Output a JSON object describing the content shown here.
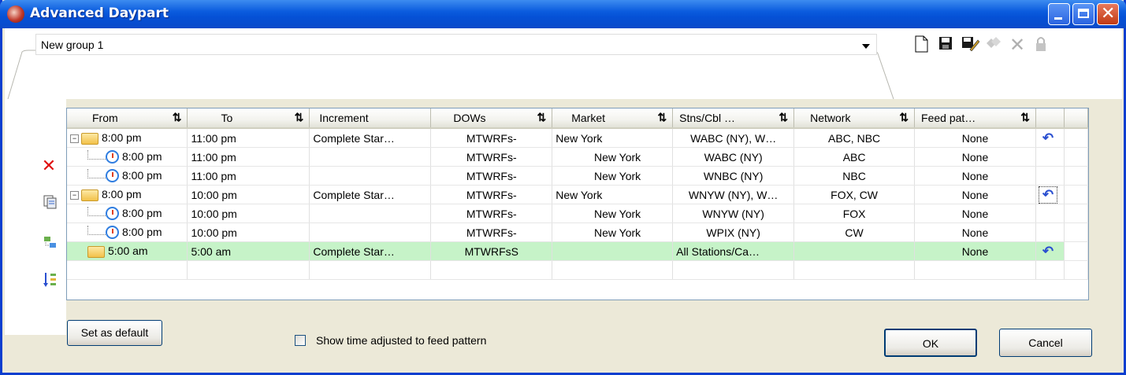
{
  "window": {
    "title": "Advanced Daypart"
  },
  "group": {
    "name": "New group 1"
  },
  "toolbar": {
    "icons": [
      "new-document-icon",
      "save-icon",
      "save-as-icon",
      "copy-group-icon",
      "delete-icon",
      "lock-icon"
    ]
  },
  "side_icons": [
    "delete-row-icon",
    "copy-row-icon",
    "group-rows-icon",
    "sort-rows-icon"
  ],
  "grid": {
    "columns": [
      "From",
      "To",
      "Increment",
      "DOWs",
      "Market",
      "Stns/Cbl …",
      "Network",
      "Feed pat…"
    ],
    "rows": [
      {
        "from": "8:00 pm",
        "to": "11:00 pm",
        "increment": "Complete Star…",
        "dows": "MTWRFs-",
        "market": "New York",
        "stations": "WABC (NY), W…",
        "network": "ABC, NBC",
        "feed": "None"
      },
      {
        "from": "8:00 pm",
        "to": "11:00 pm",
        "increment": "",
        "dows": "MTWRFs-",
        "market": "New York",
        "stations": "WABC (NY)",
        "network": "ABC",
        "feed": "None"
      },
      {
        "from": "8:00 pm",
        "to": "11:00 pm",
        "increment": "",
        "dows": "MTWRFs-",
        "market": "New York",
        "stations": "WNBC (NY)",
        "network": "NBC",
        "feed": "None"
      },
      {
        "from": "8:00 pm",
        "to": "10:00 pm",
        "increment": "Complete Star…",
        "dows": "MTWRFs-",
        "market": "New York",
        "stations": "WNYW (NY), W…",
        "network": "FOX, CW",
        "feed": "None"
      },
      {
        "from": "8:00 pm",
        "to": "10:00 pm",
        "increment": "",
        "dows": "MTWRFs-",
        "market": "New York",
        "stations": "WNYW (NY)",
        "network": "FOX",
        "feed": "None"
      },
      {
        "from": "8:00 pm",
        "to": "10:00 pm",
        "increment": "",
        "dows": "MTWRFs-",
        "market": "New York",
        "stations": "WPIX (NY)",
        "network": "CW",
        "feed": "None"
      },
      {
        "from": "5:00 am",
        "to": "5:00 am",
        "increment": "Complete Star…",
        "dows": "MTWRFsS",
        "market": "",
        "stations": "All Stations/Ca…",
        "network": "",
        "feed": "None"
      }
    ]
  },
  "buttons": {
    "set_default": "Set as default",
    "ok": "OK",
    "cancel": "Cancel"
  },
  "checkbox": {
    "label": "Show time adjusted to feed pattern",
    "checked": false
  },
  "colors": {
    "title_bar": "#0b5cde",
    "selected_row": "#c6f3c8"
  }
}
